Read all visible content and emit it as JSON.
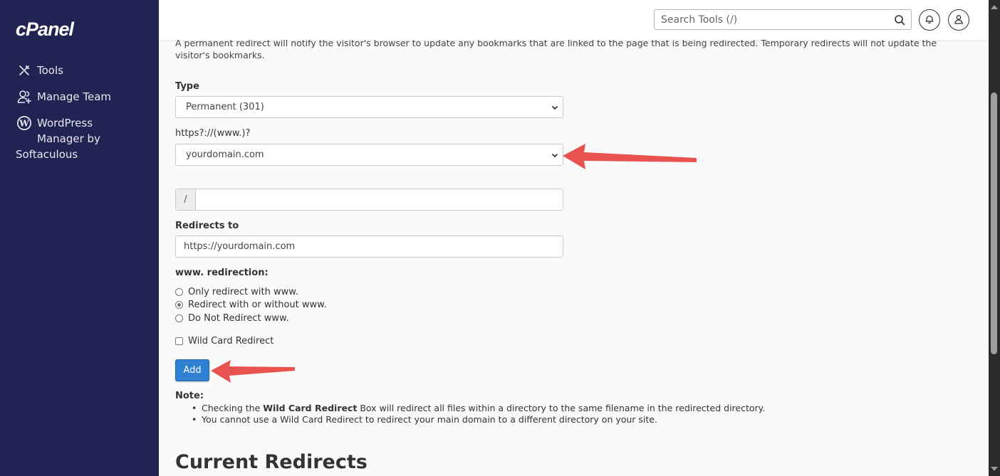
{
  "sidebar": {
    "logo": "cPanel",
    "items": [
      {
        "label": "Tools",
        "icon": "tools-icon"
      },
      {
        "label": "Manage Team",
        "icon": "manage-team-icon"
      },
      {
        "label_line1": "WordPress",
        "label_line2": "Manager by",
        "label_line3": "Softaculous",
        "icon": "wordpress-icon"
      }
    ]
  },
  "header": {
    "search_placeholder": "Search Tools (/)",
    "search_icon": "search-icon",
    "notifications_icon": "bell-icon",
    "user_icon": "user-icon"
  },
  "form": {
    "intro": "A permanent redirect will notify the visitor's browser to update any bookmarks that are linked to the page that is being redirected. Temporary redirects will not update the visitor's bookmarks.",
    "type_label": "Type",
    "type_value": "Permanent (301)",
    "domain_label": "https?://(www.)?",
    "domain_value": "yourdomain.com",
    "path_prefix": "/",
    "path_value": "",
    "redirects_to_label": "Redirects to",
    "redirects_to_value": "https://yourdomain.com",
    "www_label": "www. redirection:",
    "www_options": [
      {
        "label": "Only redirect with www.",
        "checked": false
      },
      {
        "label": "Redirect with or without www.",
        "checked": true
      },
      {
        "label": "Do Not Redirect www.",
        "checked": false
      }
    ],
    "wildcard_label": "Wild Card Redirect",
    "wildcard_checked": false,
    "add_button": "Add"
  },
  "note": {
    "title": "Note:",
    "item1_pre": "Checking the ",
    "item1_bold": "Wild Card Redirect",
    "item1_post": " Box will redirect all files within a directory to the same filename in the redirected directory.",
    "item2": "You cannot use a Wild Card Redirect to redirect your main domain to a different directory on your site."
  },
  "current_redirects_title": "Current Redirects",
  "colors": {
    "sidebar_bg": "#212452",
    "primary_button": "#2f80d0",
    "annotation_arrow": "#e8524f"
  }
}
